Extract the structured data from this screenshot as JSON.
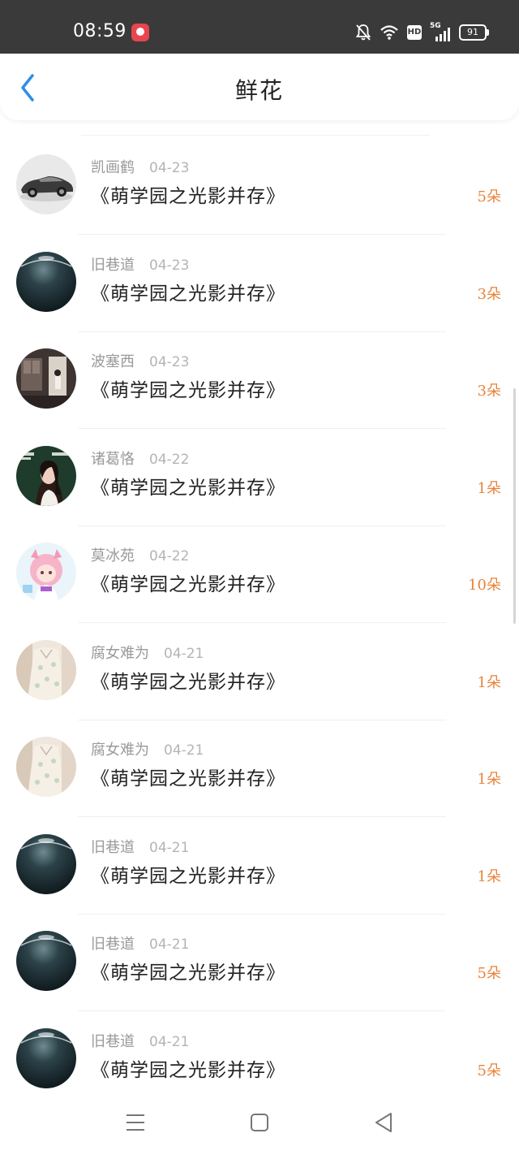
{
  "status_bar": {
    "time": "08:59",
    "network_label": "5G",
    "hd_label": "HD",
    "battery_level": "91"
  },
  "header": {
    "title": "鲜花"
  },
  "items": [
    {
      "user": "凯画鹤",
      "date": "04-23",
      "title": "《萌学园之光影并存》",
      "count": "5朵",
      "avatar": "car"
    },
    {
      "user": "旧巷道",
      "date": "04-23",
      "title": "《萌学园之光影并存》",
      "count": "3朵",
      "avatar": "planet"
    },
    {
      "user": "波塞西",
      "date": "04-23",
      "title": "《萌学园之光影并存》",
      "count": "3朵",
      "avatar": "room"
    },
    {
      "user": "诸葛恪",
      "date": "04-22",
      "title": "《萌学园之光影并存》",
      "count": "1朵",
      "avatar": "portrait"
    },
    {
      "user": "莫冰苑",
      "date": "04-22",
      "title": "《萌学园之光影并存》",
      "count": "10朵",
      "avatar": "anime"
    },
    {
      "user": "腐女难为",
      "date": "04-21",
      "title": "《萌学园之光影并存》",
      "count": "1朵",
      "avatar": "dress"
    },
    {
      "user": "腐女难为",
      "date": "04-21",
      "title": "《萌学园之光影并存》",
      "count": "1朵",
      "avatar": "dress"
    },
    {
      "user": "旧巷道",
      "date": "04-21",
      "title": "《萌学园之光影并存》",
      "count": "1朵",
      "avatar": "planet"
    },
    {
      "user": "旧巷道",
      "date": "04-21",
      "title": "《萌学园之光影并存》",
      "count": "5朵",
      "avatar": "planet"
    },
    {
      "user": "旧巷道",
      "date": "04-21",
      "title": "《萌学园之光影并存》",
      "count": "5朵",
      "avatar": "planet"
    }
  ],
  "colors": {
    "accent_back": "#2f8fe8",
    "flower_count": "#e8833a",
    "status_bar_bg": "#3a3a3a"
  },
  "icons": {
    "back": "chevron-left-icon",
    "nav_menu": "menu-icon",
    "nav_home": "home-square-icon",
    "nav_back": "triangle-back-icon"
  }
}
